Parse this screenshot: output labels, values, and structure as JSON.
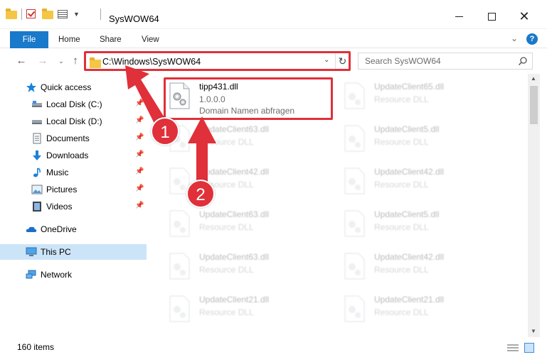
{
  "window": {
    "title": "SysWOW64",
    "minimize_label": "Minimize",
    "maximize_label": "Maximize",
    "close_label": "Close"
  },
  "ribbon": {
    "tabs": [
      {
        "label": "File"
      },
      {
        "label": "Home"
      },
      {
        "label": "Share"
      },
      {
        "label": "View"
      }
    ],
    "help": "?"
  },
  "address": {
    "path": "C:\\Windows\\SysWOW64"
  },
  "search": {
    "placeholder": "Search SysWOW64"
  },
  "sidebar": {
    "items": [
      {
        "label": "Quick access",
        "icon": "star-icon",
        "pinned": false
      },
      {
        "label": "Local Disk (C:)",
        "icon": "drive-icon",
        "pinned": true
      },
      {
        "label": "Local Disk (D:)",
        "icon": "drive-icon",
        "pinned": true
      },
      {
        "label": "Documents",
        "icon": "documents-icon",
        "pinned": true
      },
      {
        "label": "Downloads",
        "icon": "download-icon",
        "pinned": true
      },
      {
        "label": "Music",
        "icon": "music-icon",
        "pinned": true
      },
      {
        "label": "Pictures",
        "icon": "pictures-icon",
        "pinned": true
      },
      {
        "label": "Videos",
        "icon": "videos-icon",
        "pinned": true
      },
      {
        "label": "OneDrive",
        "icon": "cloud-icon",
        "pinned": false
      },
      {
        "label": "This PC",
        "icon": "computer-icon",
        "pinned": false,
        "selected": true
      },
      {
        "label": "Network",
        "icon": "network-icon",
        "pinned": false
      }
    ]
  },
  "files": {
    "highlighted": {
      "name": "tipp431.dll",
      "version": "1.0.0.0",
      "description": "Domain Namen abfragen"
    },
    "faded": [
      {
        "name": "UpdateClient65.dll",
        "description": "Resource DLL"
      },
      {
        "name": "UpdateClient63.dll",
        "description": "Resource DLL"
      },
      {
        "name": "UpdateClient5.dll",
        "description": "Resource DLL"
      },
      {
        "name": "UpdateClient42.dll",
        "description": "Resource DLL"
      },
      {
        "name": "UpdateClient42.dll",
        "description": "Resource DLL"
      },
      {
        "name": "UpdateClient63.dll",
        "description": "Resource DLL"
      },
      {
        "name": "UpdateClient5.dll",
        "description": "Resource DLL"
      },
      {
        "name": "UpdateClient63.dll",
        "description": "Resource DLL"
      },
      {
        "name": "UpdateClient42.dll",
        "description": "Resource DLL"
      },
      {
        "name": "UpdateClient21.dll",
        "description": "Resource DLL"
      },
      {
        "name": "UpdateClient21.dll",
        "description": "Resource DLL"
      }
    ]
  },
  "status": {
    "item_count": "160 items"
  },
  "annotations": {
    "step1": "1",
    "step2": "2",
    "accent_color": "#e0303a"
  }
}
